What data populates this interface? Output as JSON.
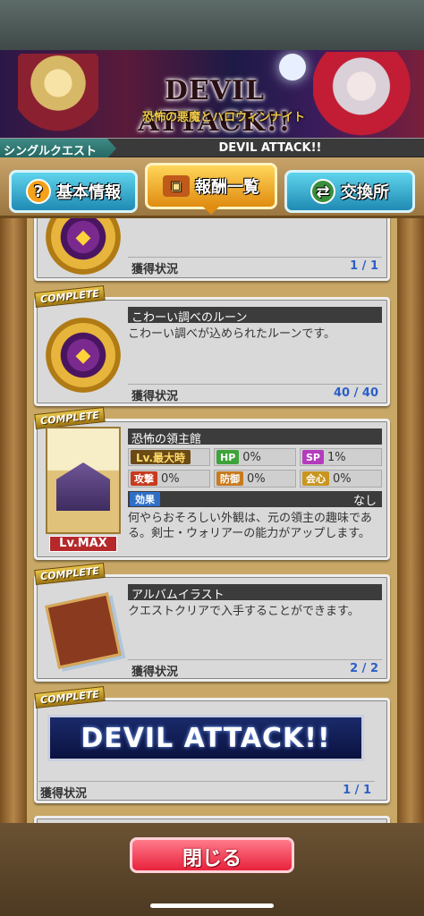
{
  "banner": {
    "logo": "DEVIL ATTACK!!",
    "subtitle": "恐怖の悪魔とハロウィンナイト"
  },
  "quest_bar": {
    "type": "シングルクエスト",
    "name": "DEVIL ATTACK!!"
  },
  "tabs": [
    {
      "label": "基本情報",
      "icon": "question-icon"
    },
    {
      "label": "報酬一覧",
      "icon": "chest-icon"
    },
    {
      "label": "交換所",
      "icon": "exchange-icon"
    }
  ],
  "rewards": {
    "acq_label": "獲得状況",
    "complete": "COMPLETE",
    "item1": {
      "value": "1 / 1"
    },
    "item2": {
      "title": "こわーい調べのルーン",
      "desc": "こわーい調べが込められたルーンです。",
      "value": "40 / 40"
    },
    "item3": {
      "title": "恐怖の領主館",
      "lv_label": "Lv.最大時",
      "hp_label": "HP",
      "hp_value": "0%",
      "sp_label": "SP",
      "sp_value": "1%",
      "atk_label": "攻撃",
      "atk_value": "0%",
      "def_label": "防御",
      "def_value": "0%",
      "crit_label": "会心",
      "crit_value": "0%",
      "effect_label": "効果",
      "effect_value": "なし",
      "desc": "何やらおそろしい外観は、元の領主の趣味である。剣士・ウォリアーの能力がアップします。",
      "level": "Lv.MAX"
    },
    "item4": {
      "title": "アルバムイラスト",
      "desc": "クエストクリアで入手することができます。",
      "value": "2 / 2"
    },
    "item5": {
      "title": "DEVIL ATTACK!!",
      "value": "1 / 1"
    }
  },
  "close_label": "閉じる",
  "colors": {
    "accent_gold": "#e08c10",
    "tab_blue": "#1f8ab3",
    "close_red": "#e8223c",
    "progress_blue": "#2b5fc8"
  }
}
